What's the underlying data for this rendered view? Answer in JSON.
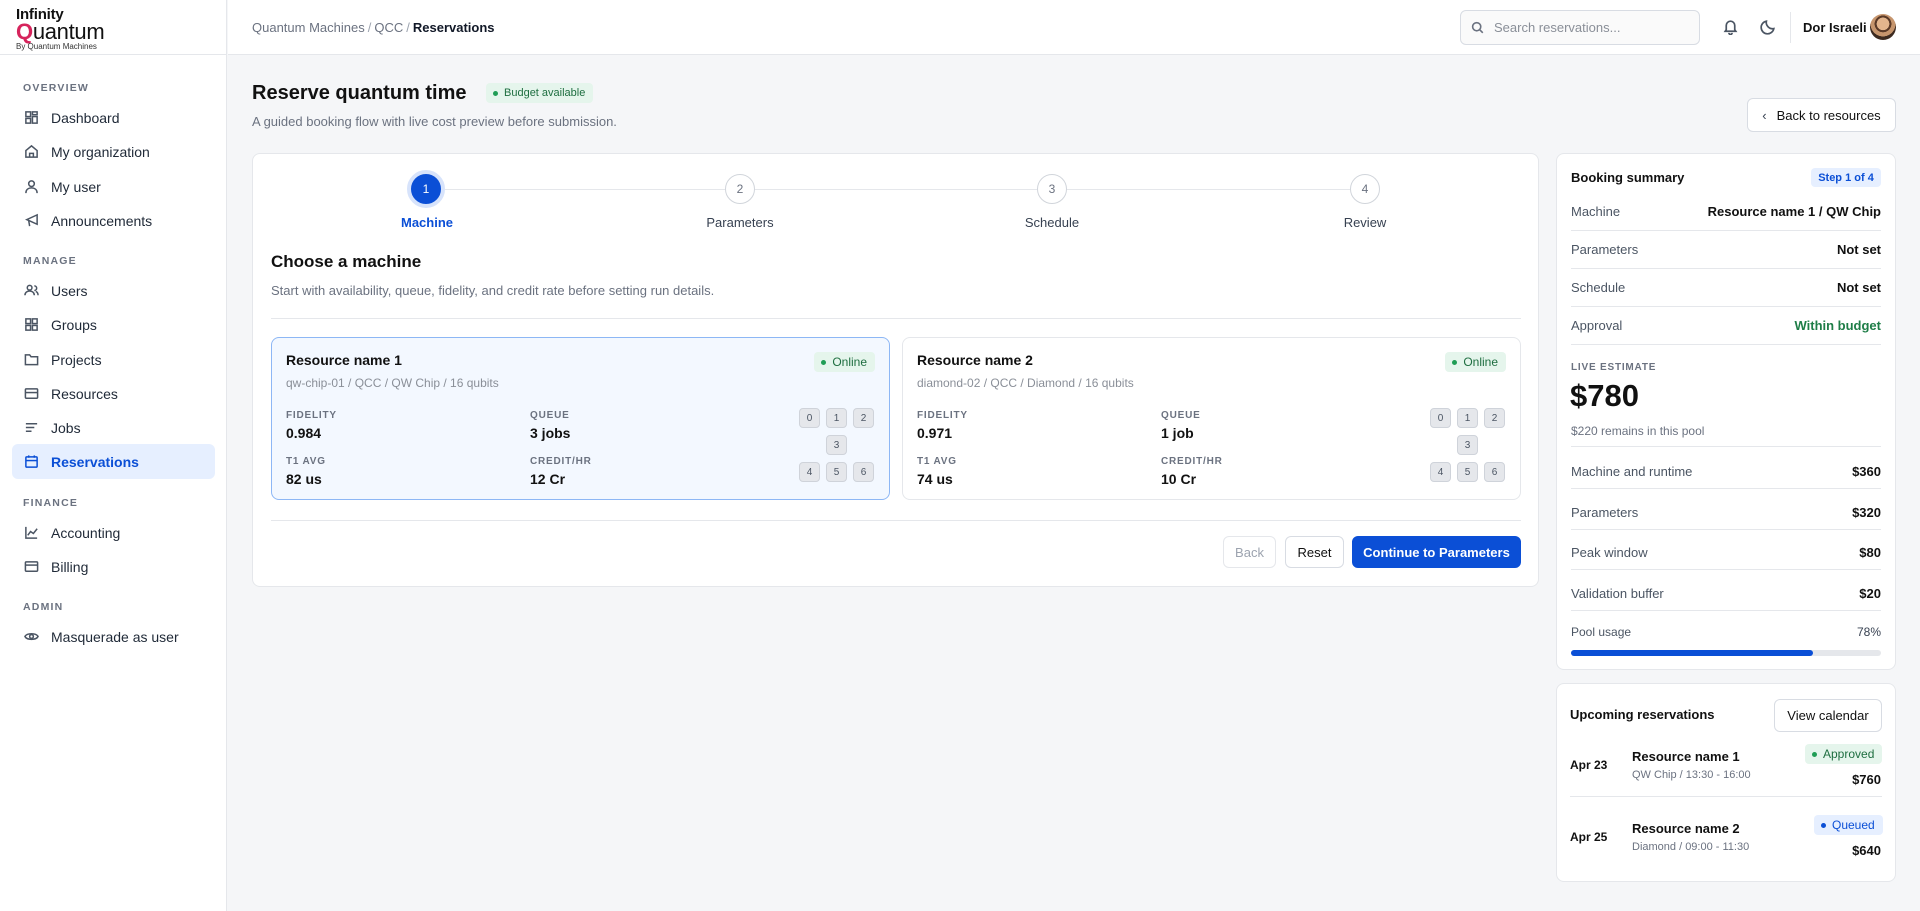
{
  "logo": {
    "line1": "Infinity",
    "line2_q": "Q",
    "line2_rest": "uantum",
    "line3": "By Quantum Machines"
  },
  "sidebar": {
    "sections": [
      "OVERVIEW",
      "MANAGE",
      "FINANCE",
      "ADMIN"
    ],
    "items": [
      {
        "label": "Dashboard",
        "icon": "dashboard-icon"
      },
      {
        "label": "My organization",
        "icon": "home-icon"
      },
      {
        "label": "My user",
        "icon": "user-icon"
      },
      {
        "label": "Announcements",
        "icon": "megaphone-icon"
      },
      {
        "label": "Users",
        "icon": "users-icon"
      },
      {
        "label": "Groups",
        "icon": "groups-icon"
      },
      {
        "label": "Projects",
        "icon": "folder-icon"
      },
      {
        "label": "Resources",
        "icon": "server-icon"
      },
      {
        "label": "Jobs",
        "icon": "list-icon"
      },
      {
        "label": "Reservations",
        "icon": "calendar-icon"
      },
      {
        "label": "Accounting",
        "icon": "chart-icon"
      },
      {
        "label": "Billing",
        "icon": "card-icon"
      },
      {
        "label": "Masquerade as user",
        "icon": "eye-icon"
      }
    ]
  },
  "topbar": {
    "breadcrumb": [
      "Quantum Machines",
      "QCC",
      "Reservations"
    ],
    "search_placeholder": "Search reservations...",
    "user_name": "Dor Israeli"
  },
  "header": {
    "title": "Reserve quantum time",
    "badge": "Budget available",
    "subtitle": "A guided booking flow with live cost preview before submission.",
    "back_button": "Back to resources"
  },
  "steps": [
    {
      "num": "1",
      "label": "Machine"
    },
    {
      "num": "2",
      "label": "Parameters"
    },
    {
      "num": "3",
      "label": "Schedule"
    },
    {
      "num": "4",
      "label": "Review"
    }
  ],
  "section": {
    "title": "Choose a machine",
    "subtitle": "Start with availability, queue, fidelity, and credit rate before setting run details."
  },
  "resources": [
    {
      "name": "Resource name 1",
      "meta": "qw-chip-01 / QCC / QW Chip / 16 qubits",
      "status": "Online",
      "fidelity_label": "FIDELITY",
      "fidelity": "0.984",
      "queue_label": "QUEUE",
      "queue": "3 jobs",
      "t1_label": "T1 AVG",
      "t1": "82 us",
      "credit_label": "CREDIT/HR",
      "credit": "12 Cr",
      "qubits": [
        "0",
        "1",
        "2",
        "3",
        "4",
        "5",
        "6"
      ]
    },
    {
      "name": "Resource name 2",
      "meta": "diamond-02 / QCC / Diamond / 16 qubits",
      "status": "Online",
      "fidelity_label": "FIDELITY",
      "fidelity": "0.971",
      "queue_label": "QUEUE",
      "queue": "1 job",
      "t1_label": "T1 AVG",
      "t1": "74 us",
      "credit_label": "CREDIT/HR",
      "credit": "10 Cr",
      "qubits": [
        "0",
        "1",
        "2",
        "3",
        "4",
        "5",
        "6"
      ]
    }
  ],
  "actions": {
    "back": "Back",
    "reset": "Reset",
    "continue": "Continue to Parameters"
  },
  "summary": {
    "title": "Booking summary",
    "step_badge": "Step 1 of 4",
    "rows": [
      {
        "label": "Machine",
        "value": "Resource name 1 / QW Chip"
      },
      {
        "label": "Parameters",
        "value": "Not set"
      },
      {
        "label": "Schedule",
        "value": "Not set"
      },
      {
        "label": "Approval",
        "value": "Within budget"
      }
    ],
    "live_label": "LIVE ESTIMATE",
    "live_amount": "$780",
    "live_sub": "$220 remains in this pool",
    "costs": [
      {
        "label": "Machine and runtime",
        "value": "$360"
      },
      {
        "label": "Parameters",
        "value": "$320"
      },
      {
        "label": "Peak window",
        "value": "$80"
      },
      {
        "label": "Validation buffer",
        "value": "$20"
      }
    ],
    "pool_label": "Pool usage",
    "pool_value": "78%",
    "pool_fraction": 0.78
  },
  "upcoming": {
    "title": "Upcoming reservations",
    "calendar_button": "View calendar",
    "items": [
      {
        "date": "Apr 23",
        "name": "Resource name 1",
        "meta": "QW Chip / 13:30 - 16:00",
        "status": "Approved",
        "amount": "$760"
      },
      {
        "date": "Apr 25",
        "name": "Resource name 2",
        "meta": "Diamond / 09:00 - 11:30",
        "status": "Queued",
        "amount": "$640"
      }
    ]
  },
  "colors": {
    "accent": "#0b4fd6",
    "success": "#1f9d55",
    "brand": "#d6245c"
  }
}
